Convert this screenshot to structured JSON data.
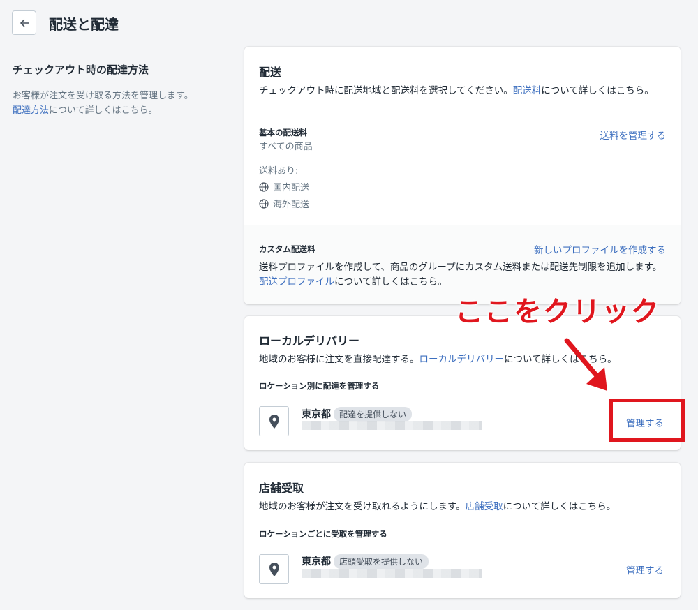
{
  "header": {
    "title": "配送と配達"
  },
  "sidebar": {
    "title": "チェックアウト時の配達方法",
    "desc_pre": "お客様が注文を受け取る方法を管理します。",
    "desc_link": "配達方法",
    "desc_post": "について詳しくはこちら。"
  },
  "shipping": {
    "title": "配送",
    "desc_pre": "チェックアウト時に配送地域と配送料を選択してください。",
    "desc_link": "配送料",
    "desc_post": "について詳しくはこちら。",
    "base_title": "基本の配送料",
    "base_sub": "すべての商品",
    "manage_rates": "送料を管理する",
    "rates_label": "送料あり:",
    "zones": [
      "国内配送",
      "海外配送"
    ],
    "custom_title": "カスタム配送料",
    "create_profile": "新しいプロファイルを作成する",
    "custom_desc_pre": "送料プロファイルを作成して、商品のグループにカスタム送料または配送先制限を追加します。",
    "custom_desc_link": "配送プロファイル",
    "custom_desc_post": "について詳しくはこちら。"
  },
  "local": {
    "title": "ローカルデリバリー",
    "desc_pre": "地域のお客様に注文を直接配達する。",
    "desc_link": "ローカルデリバリー",
    "desc_post": "について詳しくはこちら。",
    "sub_title": "ロケーション別に配達を管理する",
    "location": "東京都",
    "badge": "配達を提供しない",
    "manage": "管理する"
  },
  "pickup": {
    "title": "店舗受取",
    "desc_pre": "地域のお客様が注文を受け取れるようにします。",
    "desc_link": "店舗受取",
    "desc_post": "について詳しくはこちら。",
    "sub_title": "ロケーションごとに受取を管理する",
    "location": "東京都",
    "badge": "店頭受取を提供しない",
    "manage": "管理する"
  },
  "annotation": {
    "text": "ここをクリック",
    "color": "#e0161e"
  },
  "icons": {
    "back": "arrow-left-icon",
    "zone": "globe-icon",
    "location": "location-pin-icon"
  }
}
